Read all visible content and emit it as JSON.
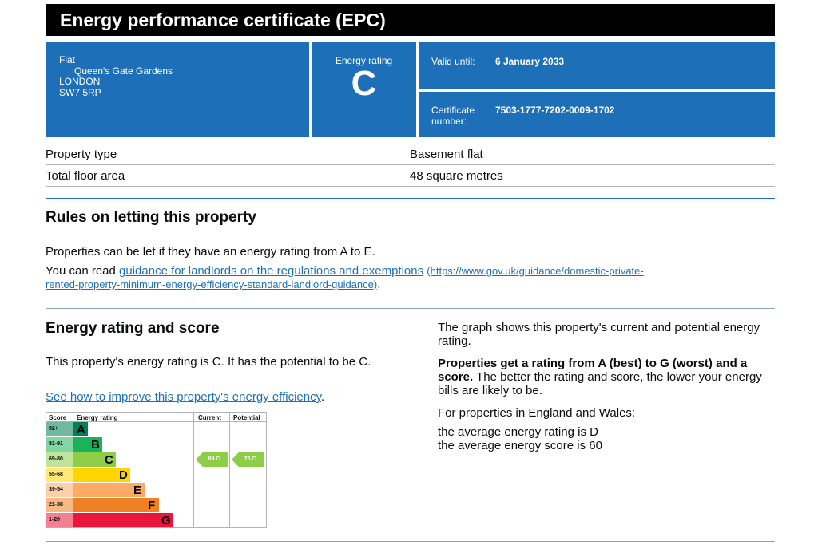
{
  "header": {
    "title": "Energy performance certificate (EPC)"
  },
  "address": {
    "line1": "Flat",
    "line2": "Queen's Gate Gardens",
    "line3": "LONDON",
    "line4": "SW7 5RP"
  },
  "energy_rating": {
    "label": "Energy rating",
    "value": "C"
  },
  "validity": {
    "label": "Valid until:",
    "value": "6 January 2033"
  },
  "certificate": {
    "label": "Certificate number:",
    "value": "7503-1777-7202-0009-1702"
  },
  "property": [
    {
      "label": "Property type",
      "value": "Basement flat"
    },
    {
      "label": "Total floor area",
      "value": "48 square metres"
    }
  ],
  "letting": {
    "heading": "Rules on letting this property",
    "text": "Properties can be let if they have an energy rating from A to E.",
    "read_prefix": "You can read ",
    "link_text": "guidance for landlords on the regulations and exemptions",
    "link_url_line1": "(https://www.gov.uk/guidance/domestic-private-",
    "link_url_line2": "rented-property-minimum-energy-efficiency-standard-landlord-guidance)",
    "suffix": "."
  },
  "rating_score": {
    "heading": "Energy rating and score",
    "text": "This property's energy rating is C. It has the potential to be C.",
    "link_text": "See how to improve this property's energy efficiency",
    "suffix": ".",
    "right_p1": "The graph shows this property's current and potential energy rating.",
    "right_p2_bold": "Properties get a rating from A (best) to G (worst) and a score.",
    "right_p2_rest": " The better the rating and score, the lower your energy bills are likely to be.",
    "right_p3": "For properties in England and Wales:",
    "right_p4": "the average energy rating is D",
    "right_p5": "the average energy score is 60"
  },
  "chart_data": {
    "type": "bar",
    "headers": {
      "score": "Score",
      "rating": "Energy rating",
      "current": "Current",
      "potential": "Potential"
    },
    "bands": [
      {
        "score": "92+",
        "letter": "A",
        "color": "#008054"
      },
      {
        "score": "81-91",
        "letter": "B",
        "color": "#19b459"
      },
      {
        "score": "69-80",
        "letter": "C",
        "color": "#8dce46"
      },
      {
        "score": "55-68",
        "letter": "D",
        "color": "#ffd500"
      },
      {
        "score": "39-54",
        "letter": "E",
        "color": "#fcaa65"
      },
      {
        "score": "21-38",
        "letter": "F",
        "color": "#ef8023"
      },
      {
        "score": "1-20",
        "letter": "G",
        "color": "#e9153b"
      }
    ],
    "current": {
      "score": 69,
      "letter": "C",
      "label": "69 C"
    },
    "potential": {
      "score": 75,
      "letter": "C",
      "label": "75 C"
    }
  }
}
